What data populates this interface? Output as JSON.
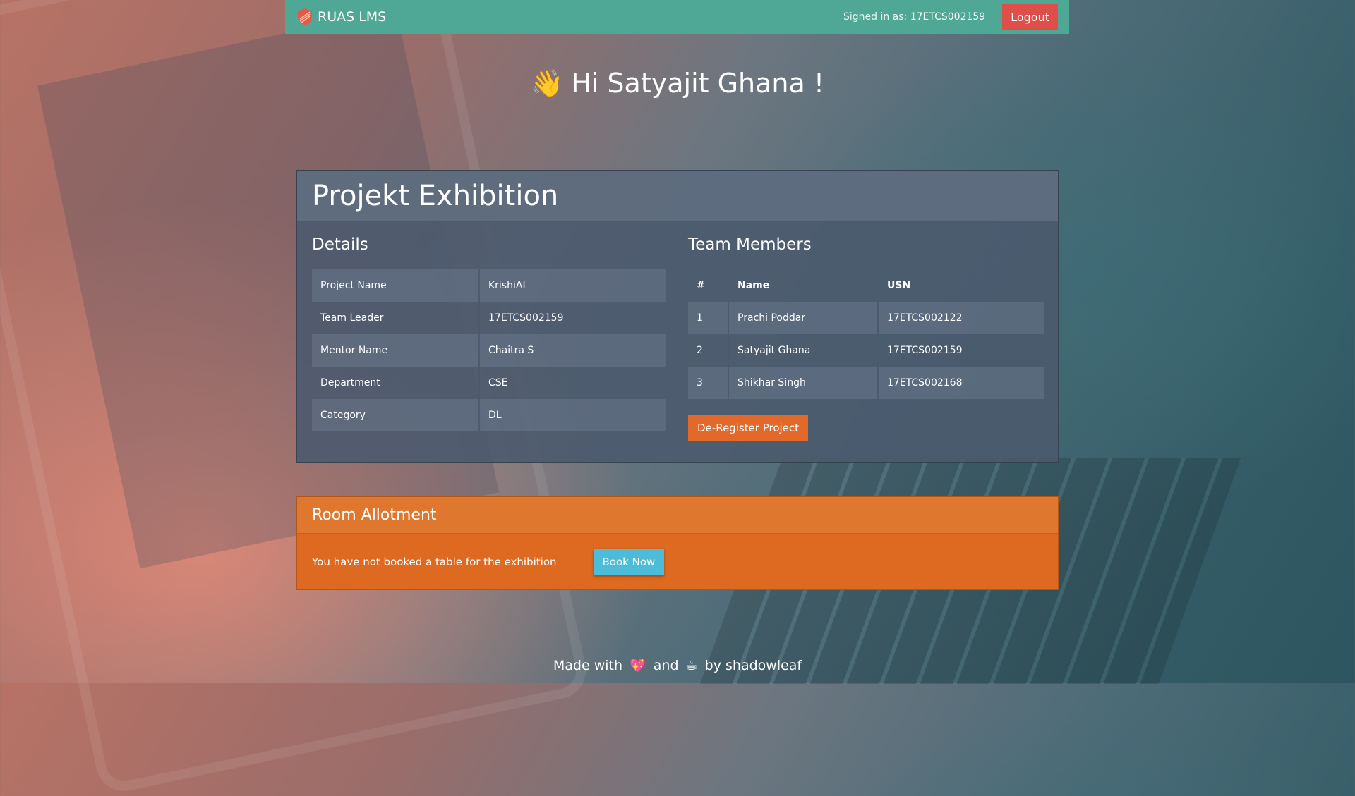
{
  "navbar": {
    "brand": "RUAS LMS",
    "signed_in_label": "Signed in as:",
    "signed_in_user": "17ETCS002159",
    "logout_label": "Logout"
  },
  "greeting": {
    "wave_emoji": "👋",
    "text": "Hi Satyajit Ghana !"
  },
  "project_card": {
    "title": "Projekt Exhibition",
    "details_title": "Details",
    "details": [
      {
        "label": "Project Name",
        "value": "KrishiAI"
      },
      {
        "label": "Team Leader",
        "value": "17ETCS002159"
      },
      {
        "label": "Mentor Name",
        "value": "Chaitra S"
      },
      {
        "label": "Department",
        "value": "CSE"
      },
      {
        "label": "Category",
        "value": "DL"
      }
    ],
    "team_title": "Team Members",
    "team_headers": [
      "#",
      "Name",
      "USN"
    ],
    "team": [
      {
        "num": "1",
        "name": "Prachi Poddar",
        "usn": "17ETCS002122"
      },
      {
        "num": "2",
        "name": "Satyajit Ghana",
        "usn": "17ETCS002159"
      },
      {
        "num": "3",
        "name": "Shikhar Singh",
        "usn": "17ETCS002168"
      }
    ],
    "deregister_label": "De-Register Project"
  },
  "room_allotment": {
    "title": "Room Allotment",
    "message": "You have not booked a table for the exhibition",
    "book_label": "Book Now"
  },
  "footer": {
    "made_with": "Made with",
    "heart_emoji": "💖",
    "and": "and",
    "coffee_emoji": "☕",
    "by": "by shadowleaf"
  },
  "colors": {
    "navbar": "#4fa795",
    "logout": "#e04e4a",
    "card": "#4b5a6e",
    "accent_orange": "#de6a22",
    "book_button": "#4dbcd9"
  }
}
